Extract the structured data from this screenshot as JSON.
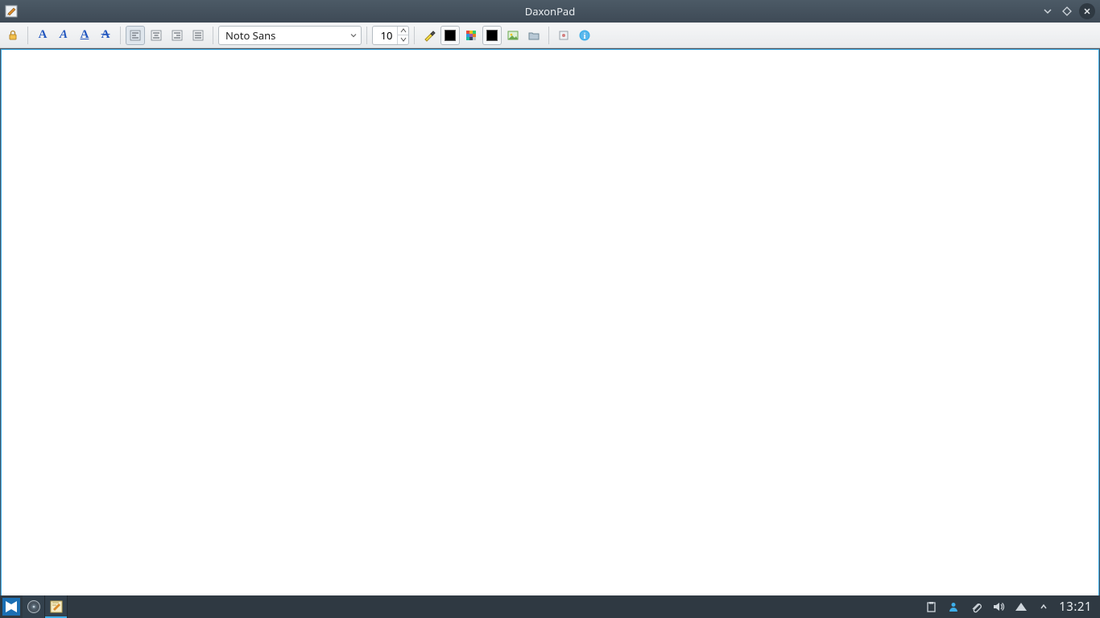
{
  "window": {
    "title": "DaxonPad"
  },
  "toolbar": {
    "font_name": "Noto Sans",
    "font_size": "10"
  },
  "taskbar": {
    "clock": "13:21"
  },
  "colors": {
    "text_color": "#000000",
    "fill_color": "#000000"
  }
}
